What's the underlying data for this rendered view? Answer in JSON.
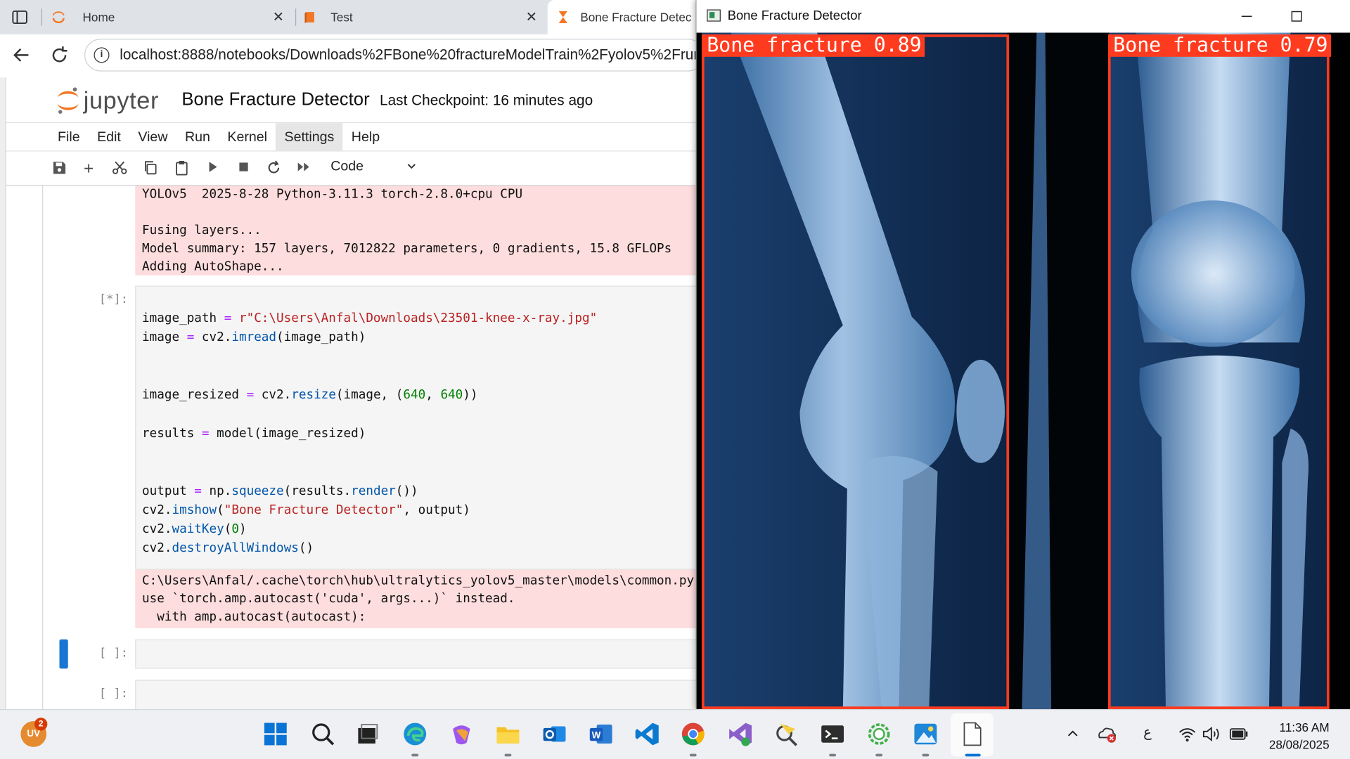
{
  "browser": {
    "tabs": [
      {
        "title": "Home"
      },
      {
        "title": "Test"
      },
      {
        "title": "Bone Fracture Detec"
      }
    ],
    "close_glyph": "✕",
    "url": "localhost:8888/notebooks/Downloads%2FBone%20fractureModelTrain%2Fyolov5%2Frun"
  },
  "jupyter": {
    "logo_text": "jupyter",
    "notebook_title": "Bone Fracture Detector",
    "checkpoint": "Last Checkpoint: 16 minutes ago",
    "menu": [
      "File",
      "Edit",
      "View",
      "Run",
      "Kernel",
      "Settings",
      "Help"
    ],
    "active_menu": "Settings",
    "cell_type": "Code",
    "output1": "YOLOv5  2025-8-28 Python-3.11.3 torch-2.8.0+cpu CPU\n\nFusing layers...\nModel summary: 157 layers, 7012822 parameters, 0 gradients, 15.8 GFLOPs\nAdding AutoShape...",
    "cell_prompt_running": "[*]:",
    "cell_prompt_empty": "[ ]:",
    "code": {
      "l1_a": "image_path",
      "l1_b": " = ",
      "l1_c": "r\"C:\\Users\\Anfal\\Downloads\\23501-knee-x-ray.jpg\"",
      "l2_a": "image",
      "l2_b": " = ",
      "l2_c": "cv2.",
      "l2_d": "imread",
      "l2_e": "(image_path)",
      "l3_a": "image_resized",
      "l3_b": " = ",
      "l3_c": "cv2.",
      "l3_d": "resize",
      "l3_e": "(image, (",
      "l3_f": "640",
      "l3_g": ", ",
      "l3_h": "640",
      "l3_i": "))",
      "l4_a": "results",
      "l4_b": " = ",
      "l4_c": "model(image_resized)",
      "l5_a": "output",
      "l5_b": " = ",
      "l5_c": "np.",
      "l5_d": "squeeze",
      "l5_e": "(results.",
      "l5_f": "render",
      "l5_g": "())",
      "l6_a": "cv2.",
      "l6_b": "imshow",
      "l6_c": "(",
      "l6_d": "\"Bone Fracture Detector\"",
      "l6_e": ", output)",
      "l7_a": "cv2.",
      "l7_b": "waitKey",
      "l7_c": "(",
      "l7_d": "0",
      "l7_e": ")",
      "l8_a": "cv2.",
      "l8_b": "destroyAllWindows",
      "l8_c": "()"
    },
    "output2": "C:\\Users\\Anfal/.cache\\torch\\hub\\ultralytics_yolov5_master\\models\\common.py\nuse `torch.amp.autocast('cuda', args...)` instead.\n  with amp.autocast(autocast):"
  },
  "cv_window": {
    "title": "Bone Fracture Detector",
    "detections": [
      {
        "label": "Bone fracture 0.89"
      },
      {
        "label": "Bone fracture 0.79"
      }
    ]
  },
  "taskbar": {
    "avatar_initials": "UV",
    "notification_count": "2",
    "language": "ع",
    "time": "11:36 AM",
    "date": "28/08/2025"
  },
  "colors": {
    "detection_box": "#ff3b1f",
    "stderr_bg": "#fddddd",
    "jupyter_orange": "#f37726"
  }
}
